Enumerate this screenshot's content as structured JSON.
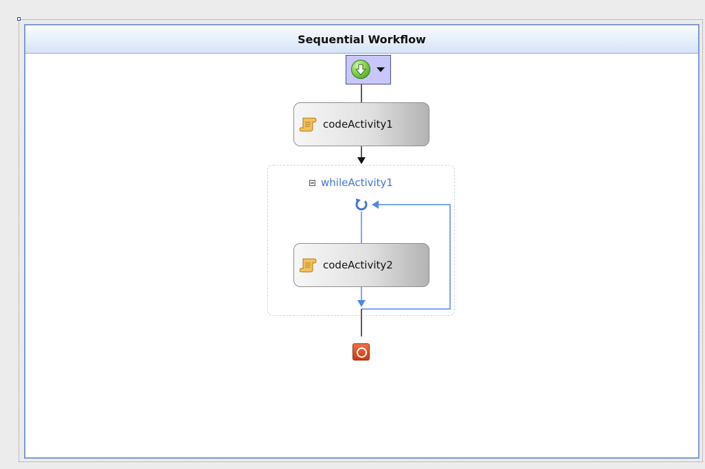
{
  "workflow": {
    "title": "Sequential Workflow",
    "start_icon": "down-arrow-circle-icon",
    "end_icon": "stop-circle-icon",
    "activities": [
      {
        "label": "codeActivity1",
        "icon": "script-scroll-icon"
      }
    ],
    "while_activity": {
      "label": "whileActivity1",
      "loop_icon": "loop-arrow-icon",
      "children": [
        {
          "label": "codeActivity2",
          "icon": "script-scroll-icon"
        }
      ]
    }
  },
  "colors": {
    "header_border": "#7e99cf",
    "loop_blue": "#4f86f0",
    "start_bg": "#c7c7fb",
    "end_red": "#d9461e"
  }
}
